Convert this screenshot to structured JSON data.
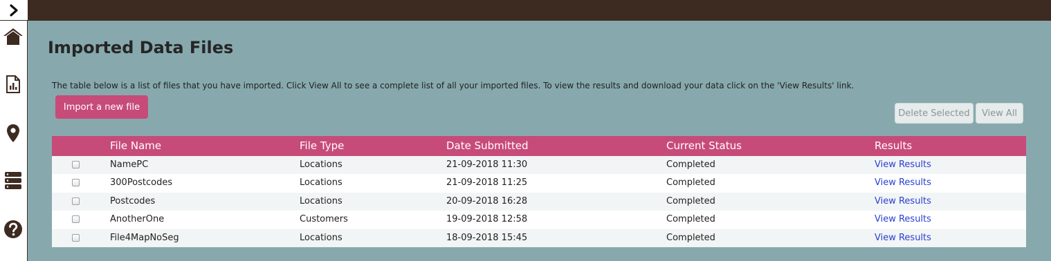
{
  "page": {
    "title": "Imported Data Files",
    "description": "The table below is a list of files that you have imported. Click View All to see a complete list of all your imported files. To view the results and download your data click on the 'View Results' link."
  },
  "actions": {
    "import_label": "Import a new file",
    "delete_label": "Delete Selected",
    "view_all_label": "View All"
  },
  "sidebar": {
    "icons": [
      "chevron-right-icon",
      "home-icon",
      "report-icon",
      "map-pin-icon",
      "database-icon",
      "help-icon"
    ]
  },
  "colors": {
    "accent": "#c74b79",
    "background": "#87a9ad",
    "topbar": "#3d2b21",
    "link": "#2a3ed2"
  },
  "table": {
    "headers": {
      "file_name": "File Name",
      "file_type": "File Type",
      "date_submitted": "Date Submitted",
      "current_status": "Current Status",
      "results": "Results"
    },
    "rows": [
      {
        "file_name": "NamePC",
        "file_type": "Locations",
        "date_submitted": "21-09-2018 11:30",
        "status": "Completed",
        "results": "View Results"
      },
      {
        "file_name": "300Postcodes",
        "file_type": "Locations",
        "date_submitted": "21-09-2018 11:25",
        "status": "Completed",
        "results": "View Results"
      },
      {
        "file_name": "Postcodes",
        "file_type": "Locations",
        "date_submitted": "20-09-2018 16:28",
        "status": "Completed",
        "results": "View Results"
      },
      {
        "file_name": "AnotherOne",
        "file_type": "Customers",
        "date_submitted": "19-09-2018 12:58",
        "status": "Completed",
        "results": "View Results"
      },
      {
        "file_name": "File4MapNoSeg",
        "file_type": "Locations",
        "date_submitted": "18-09-2018 15:45",
        "status": "Completed",
        "results": "View Results"
      }
    ]
  }
}
